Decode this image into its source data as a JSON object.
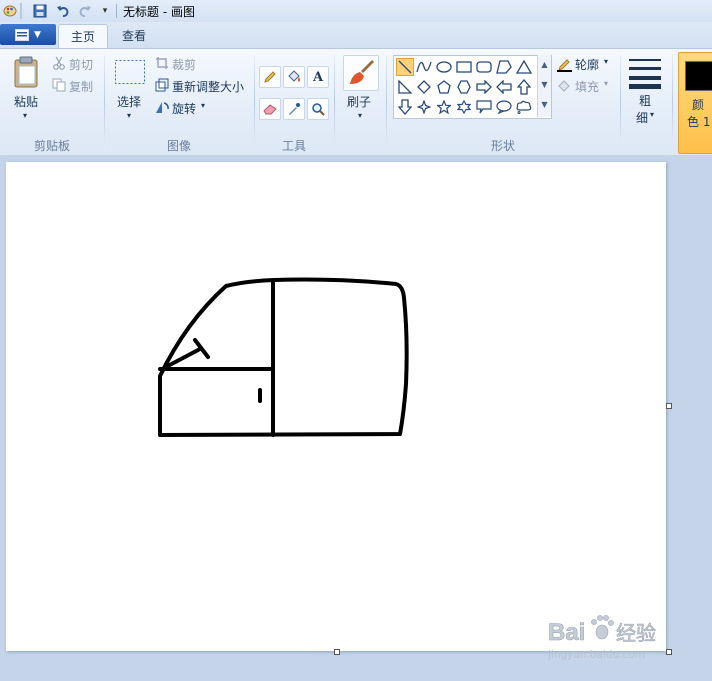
{
  "window": {
    "title": "无标题 - 画图"
  },
  "tabs": [
    {
      "label": "主页",
      "active": true
    },
    {
      "label": "查看",
      "active": false
    }
  ],
  "ribbon": {
    "clipboard": {
      "group_label": "剪贴板",
      "paste_label": "粘贴",
      "cut_label": "剪切",
      "copy_label": "复制"
    },
    "image": {
      "group_label": "图像",
      "select_label": "选择",
      "crop_label": "裁剪",
      "resize_label": "重新调整大小",
      "rotate_label": "旋转"
    },
    "tools": {
      "group_label": "工具",
      "items": [
        "pencil-icon",
        "fill-icon",
        "text-icon",
        "eraser-icon",
        "color-picker-icon",
        "magnifier-icon"
      ],
      "text_glyph": "A"
    },
    "brushes": {
      "label": "刷子"
    },
    "shapes": {
      "group_label": "形状",
      "outline_label": "轮廓",
      "fill_label": "填充",
      "selected": "line"
    },
    "size": {
      "label_top": "粗",
      "label_bottom": "细"
    },
    "color1": {
      "label_top": "颜",
      "label_bottom": "色 1",
      "value": "#000000"
    }
  },
  "canvas": {
    "background": "#ffffff",
    "stroke_color": "#000000"
  },
  "watermark": {
    "brand_left": "Bai",
    "brand_right": "经验",
    "url": "jingyan.baidu.com"
  }
}
